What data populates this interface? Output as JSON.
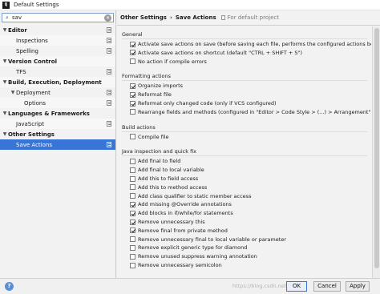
{
  "window": {
    "title": "Default Settings",
    "app_icon_text": "IJ"
  },
  "search": {
    "value": "sav",
    "placeholder": ""
  },
  "tree": [
    {
      "label": "Editor",
      "level": 0,
      "bold": true,
      "expanded": true,
      "copy": true,
      "selected": false
    },
    {
      "label": "Inspections",
      "level": 1,
      "bold": false,
      "copy": true,
      "selected": false
    },
    {
      "label": "Spelling",
      "level": 1,
      "bold": false,
      "copy": true,
      "selected": false
    },
    {
      "label": "Version Control",
      "level": 0,
      "bold": true,
      "expanded": true,
      "copy": false,
      "selected": false
    },
    {
      "label": "TFS",
      "level": 1,
      "bold": false,
      "copy": true,
      "selected": false
    },
    {
      "label": "Build, Execution, Deployment",
      "level": 0,
      "bold": true,
      "expanded": true,
      "copy": false,
      "selected": false
    },
    {
      "label": "Deployment",
      "level": 1,
      "bold": false,
      "expanded": true,
      "copy": true,
      "selected": false
    },
    {
      "label": "Options",
      "level": 2,
      "bold": false,
      "copy": true,
      "selected": false
    },
    {
      "label": "Languages & Frameworks",
      "level": 0,
      "bold": true,
      "expanded": true,
      "copy": false,
      "selected": false
    },
    {
      "label": "JavaScript",
      "level": 1,
      "bold": false,
      "copy": true,
      "selected": false
    },
    {
      "label": "Other Settings",
      "level": 0,
      "bold": true,
      "expanded": true,
      "copy": false,
      "selected": false
    },
    {
      "label": "Save Actions",
      "level": 1,
      "bold": false,
      "copy": true,
      "selected": true
    }
  ],
  "breadcrumb": {
    "parent": "Other Settings",
    "separator": "›",
    "current": "Save Actions",
    "scope": "For default project"
  },
  "groups": [
    {
      "title": "General",
      "options": [
        {
          "label": "Activate save actions on save (before saving each file, performs the configured actions below)",
          "checked": true
        },
        {
          "label": "Activate save actions on shortcut (default \"CTRL + SHIFT + S\")",
          "checked": true
        },
        {
          "label": "No action if compile errors",
          "checked": false
        }
      ]
    },
    {
      "title": "Formatting actions",
      "options": [
        {
          "label": "Organize imports",
          "checked": true
        },
        {
          "label": "Reformat file",
          "checked": true
        },
        {
          "label": "Reformat only changed code (only if VCS configured)",
          "checked": true
        },
        {
          "label": "Rearrange fields and methods (configured in \"Editor > Code Style > (...) > Arrangement\")",
          "checked": false
        }
      ]
    },
    {
      "title": "Build actions",
      "options": [
        {
          "label": "Compile file",
          "checked": false
        }
      ]
    },
    {
      "title": "Java inspection and quick fix",
      "options": [
        {
          "label": "Add final to field",
          "checked": false
        },
        {
          "label": "Add final to local variable",
          "checked": false
        },
        {
          "label": "Add this to field access",
          "checked": false
        },
        {
          "label": "Add this to method access",
          "checked": false
        },
        {
          "label": "Add class qualifier to static member access",
          "checked": false
        },
        {
          "label": "Add missing @Override annotations",
          "checked": true
        },
        {
          "label": "Add blocks in if/while/for statements",
          "checked": true
        },
        {
          "label": "Remove unnecessary this",
          "checked": true
        },
        {
          "label": "Remove final from private method",
          "checked": true
        },
        {
          "label": "Remove unnecessary final to local variable or parameter",
          "checked": false
        },
        {
          "label": "Remove explicit generic type for diamond",
          "checked": false
        },
        {
          "label": "Remove unused suppress warning annotation",
          "checked": false
        },
        {
          "label": "Remove unnecessary semicolon",
          "checked": false
        }
      ]
    }
  ],
  "footer": {
    "help": "?",
    "watermark": "https://blog.csdn.net/...",
    "ok_label": "OK",
    "cancel_label": "Cancel",
    "apply_label": "Apply"
  }
}
